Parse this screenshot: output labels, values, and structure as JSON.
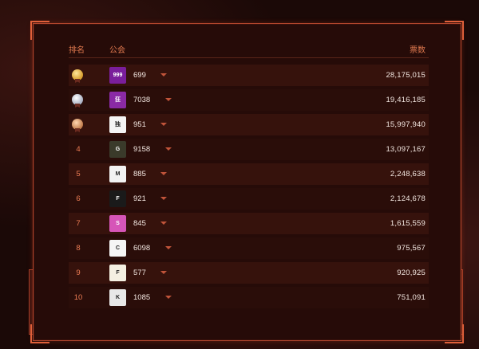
{
  "header": {
    "rank_label": "排名",
    "guild_label": "公会",
    "votes_label": "票数"
  },
  "rows": [
    {
      "rank": "1",
      "medal": "gold-medal-icon",
      "guild_id": "699",
      "votes": "28,175,015",
      "avatar_text": "999",
      "avatar_color": "#7a1e9b"
    },
    {
      "rank": "2",
      "medal": "silver-medal-icon",
      "guild_id": "7038",
      "votes": "19,416,185",
      "avatar_text": "狂",
      "avatar_color": "#8a2aa5"
    },
    {
      "rank": "3",
      "medal": "bronze-medal-icon",
      "guild_id": "951",
      "votes": "15,997,940",
      "avatar_text": "独",
      "avatar_color": "#f4f4f4"
    },
    {
      "rank": "4",
      "medal": "",
      "guild_id": "9158",
      "votes": "13,097,167",
      "avatar_text": "G",
      "avatar_color": "#3a3a2a"
    },
    {
      "rank": "5",
      "medal": "",
      "guild_id": "885",
      "votes": "2,248,638",
      "avatar_text": "M",
      "avatar_color": "#f2f2f2"
    },
    {
      "rank": "6",
      "medal": "",
      "guild_id": "921",
      "votes": "2,124,678",
      "avatar_text": "F",
      "avatar_color": "#1a1a1a"
    },
    {
      "rank": "7",
      "medal": "",
      "guild_id": "845",
      "votes": "1,615,559",
      "avatar_text": "S",
      "avatar_color": "#d655b8"
    },
    {
      "rank": "8",
      "medal": "",
      "guild_id": "6098",
      "votes": "975,567",
      "avatar_text": "C",
      "avatar_color": "#f5f5f5"
    },
    {
      "rank": "9",
      "medal": "",
      "guild_id": "577",
      "votes": "920,925",
      "avatar_text": "F",
      "avatar_color": "#f4f0e2"
    },
    {
      "rank": "10",
      "medal": "",
      "guild_id": "1085",
      "votes": "751,091",
      "avatar_text": "K",
      "avatar_color": "#e8e8e8"
    }
  ]
}
